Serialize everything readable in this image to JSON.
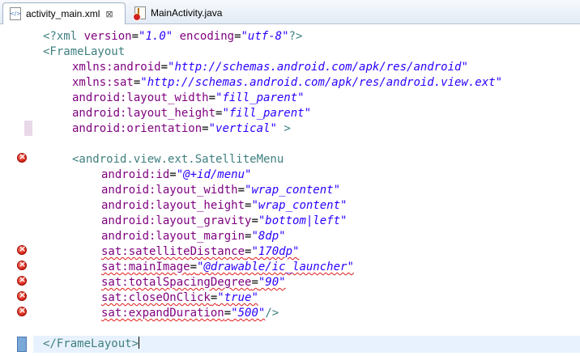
{
  "tabs": [
    {
      "label": "activity_main.xml",
      "icon": "xml-file-icon",
      "active": true
    },
    {
      "label": "MainActivity.java",
      "icon": "java-file-error-icon",
      "active": false
    }
  ],
  "close_glyph": "⊠",
  "code": {
    "l1": {
      "a": "<?xml ",
      "b": "version",
      "c": "=",
      "d": "\"1.0\"",
      "e": " ",
      "f": "encoding",
      "g": "=",
      "h": "\"utf-8\"",
      "i": "?>"
    },
    "l2": {
      "a": "<FrameLayout"
    },
    "l3": {
      "a": "xmlns:android",
      "b": "=",
      "c": "\"http://schemas.android.com/apk/res/android\""
    },
    "l4": {
      "a": "xmlns:sat",
      "b": "=",
      "c": "\"http://schemas.android.com/apk/res/android.view.ext\""
    },
    "l5": {
      "a": "android:layout_width",
      "b": "=",
      "c": "\"fill_parent\""
    },
    "l6": {
      "a": "android:layout_height",
      "b": "=",
      "c": "\"fill_parent\""
    },
    "l7": {
      "a": "android:orientation",
      "b": "=",
      "c": "\"vertical\"",
      "d": " >"
    },
    "l9": {
      "a": "<android.view.ext.SatelliteMenu"
    },
    "l10": {
      "a": "android:id",
      "b": "=",
      "c": "\"@+id/menu\""
    },
    "l11": {
      "a": "android:layout_width",
      "b": "=",
      "c": "\"wrap_content\""
    },
    "l12": {
      "a": "android:layout_height",
      "b": "=",
      "c": "\"wrap_content\""
    },
    "l13": {
      "a": "android:layout_gravity",
      "b": "=",
      "c": "\"bottom|left\""
    },
    "l14": {
      "a": "android:layout_margin",
      "b": "=",
      "c": "\"8dp\""
    },
    "l15": {
      "a": "sat:satelliteDistance",
      "b": "=",
      "c": "\"170dp\""
    },
    "l16": {
      "a": "sat:mainImage",
      "b": "=",
      "c": "\"@drawable/ic_launcher\""
    },
    "l17": {
      "a": "sat:totalSpacingDegree",
      "b": "=",
      "c": "\"90\""
    },
    "l18": {
      "a": "sat:closeOnClick",
      "b": "=",
      "c": "\"true\""
    },
    "l19": {
      "a": "sat:expandDuration",
      "b": "=",
      "c": "\"500\"",
      "d": "/>"
    },
    "l21": {
      "a": "</FrameLayout>"
    }
  }
}
